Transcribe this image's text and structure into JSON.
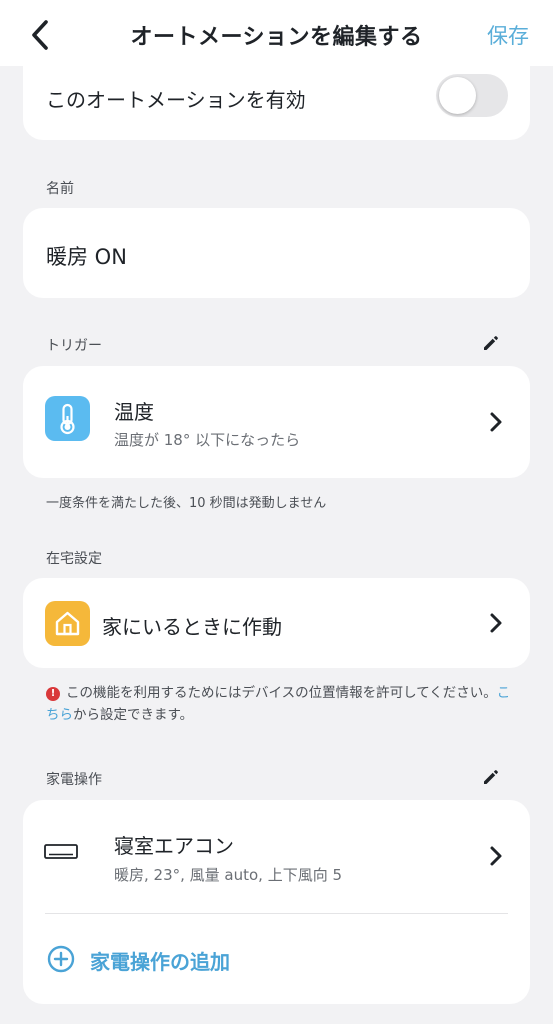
{
  "header": {
    "title": "オートメーションを編集する",
    "save_label": "保存"
  },
  "enable": {
    "label": "このオートメーションを有効",
    "enabled": false
  },
  "name_section": {
    "label": "名前",
    "value": "暖房 ON"
  },
  "trigger_section": {
    "label": "トリガー",
    "item": {
      "title": "温度",
      "subtitle": "温度が 18° 以下になったら",
      "icon": "thermometer-icon"
    },
    "note": "一度条件を満たした後、10 秒間は発動しません"
  },
  "home_section": {
    "label": "在宅設定",
    "item": {
      "title": "家にいるときに作動",
      "icon": "home-icon"
    },
    "warning_prefix": "この機能を利用するためにはデバイスの位置情報を許可してください。",
    "warning_link": "こちら",
    "warning_suffix": "から設定できます。"
  },
  "device_section": {
    "label": "家電操作",
    "item": {
      "title": "寝室エアコン",
      "subtitle": "暖房, 23°, 風量 auto, 上下風向 5",
      "icon": "air-conditioner-icon"
    },
    "add_label": "家電操作の追加"
  },
  "colors": {
    "accent": "#4aa3d6",
    "trigger_icon_bg": "#5bbbf0",
    "home_icon_bg": "#f5b83a",
    "warning": "#d9383a"
  }
}
